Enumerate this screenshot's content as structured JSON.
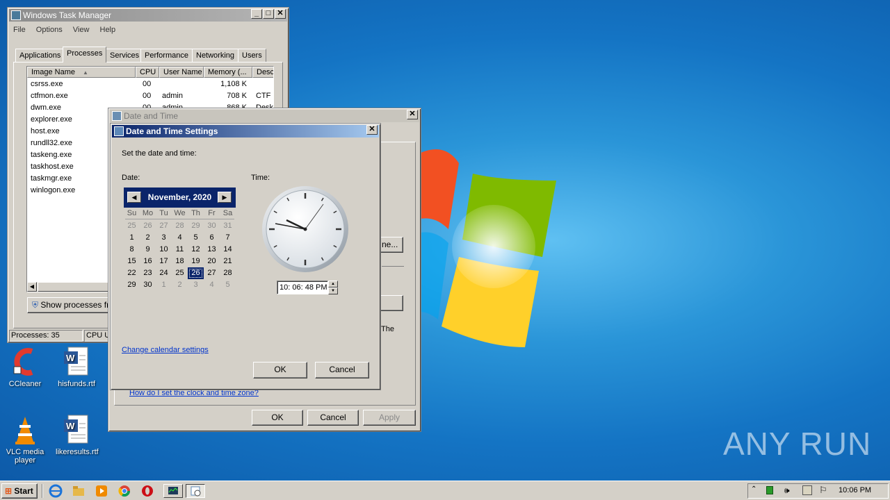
{
  "taskmgr": {
    "title": "Windows Task Manager",
    "menu": [
      "File",
      "Options",
      "View",
      "Help"
    ],
    "tabs": [
      "Applications",
      "Processes",
      "Services",
      "Performance",
      "Networking",
      "Users"
    ],
    "columns": [
      "Image Name",
      "CPU",
      "User Name",
      "Memory (...",
      "Desc"
    ],
    "rows": [
      {
        "name": "csrss.exe",
        "cpu": "00",
        "user": "",
        "mem": "1,108 K",
        "desc": ""
      },
      {
        "name": "ctfmon.exe",
        "cpu": "00",
        "user": "admin",
        "mem": "708 K",
        "desc": "CTF I"
      },
      {
        "name": "dwm.exe",
        "cpu": "00",
        "user": "admin",
        "mem": "868 K",
        "desc": "Desk"
      },
      {
        "name": "explorer.exe",
        "cpu": "",
        "user": "",
        "mem": "",
        "desc": ""
      },
      {
        "name": "host.exe",
        "cpu": "",
        "user": "",
        "mem": "",
        "desc": ""
      },
      {
        "name": "rundll32.exe",
        "cpu": "",
        "user": "",
        "mem": "",
        "desc": ""
      },
      {
        "name": "taskeng.exe",
        "cpu": "",
        "user": "",
        "mem": "",
        "desc": ""
      },
      {
        "name": "taskhost.exe",
        "cpu": "",
        "user": "",
        "mem": "",
        "desc": ""
      },
      {
        "name": "taskmgr.exe",
        "cpu": "",
        "user": "",
        "mem": "",
        "desc": ""
      },
      {
        "name": "winlogon.exe",
        "cpu": "",
        "user": "",
        "mem": "",
        "desc": ""
      }
    ],
    "show_processes_label": "Show processes fr",
    "status_processes": "Processes: 35",
    "status_cpu": "CPU Us"
  },
  "datetime": {
    "title": "Date and Time",
    "change_btn_label": "ne...",
    "partial_text": "The",
    "help_link": "How do I set the clock and time zone?",
    "ok_label": "OK",
    "cancel_label": "Cancel",
    "apply_label": "Apply"
  },
  "settings": {
    "title": "Date and Time Settings",
    "prompt": "Set the date and time:",
    "date_label": "Date:",
    "time_label": "Time:",
    "month_year": "November, 2020",
    "weekdays": [
      "Su",
      "Mo",
      "Tu",
      "We",
      "Th",
      "Fr",
      "Sa"
    ],
    "days": [
      [
        "25",
        "26",
        "27",
        "28",
        "29",
        "30",
        "31"
      ],
      [
        "1",
        "2",
        "3",
        "4",
        "5",
        "6",
        "7"
      ],
      [
        "8",
        "9",
        "10",
        "11",
        "12",
        "13",
        "14"
      ],
      [
        "15",
        "16",
        "17",
        "18",
        "19",
        "20",
        "21"
      ],
      [
        "22",
        "23",
        "24",
        "25",
        "26",
        "27",
        "28"
      ],
      [
        "29",
        "30",
        "1",
        "2",
        "3",
        "4",
        "5"
      ]
    ],
    "selected_day": "26",
    "time_value": "10: 06: 48 PM",
    "change_calendar_link": "Change calendar settings",
    "ok_label": "OK",
    "cancel_label": "Cancel"
  },
  "desktop_icons": [
    {
      "label": "CCleaner"
    },
    {
      "label": "hisfunds.rtf"
    },
    {
      "label": "VLC media player"
    },
    {
      "label": "likeresults.rtf"
    }
  ],
  "watermark": "ANY RUN",
  "taskbar": {
    "start_label": "Start",
    "clock": "10:06 PM"
  }
}
